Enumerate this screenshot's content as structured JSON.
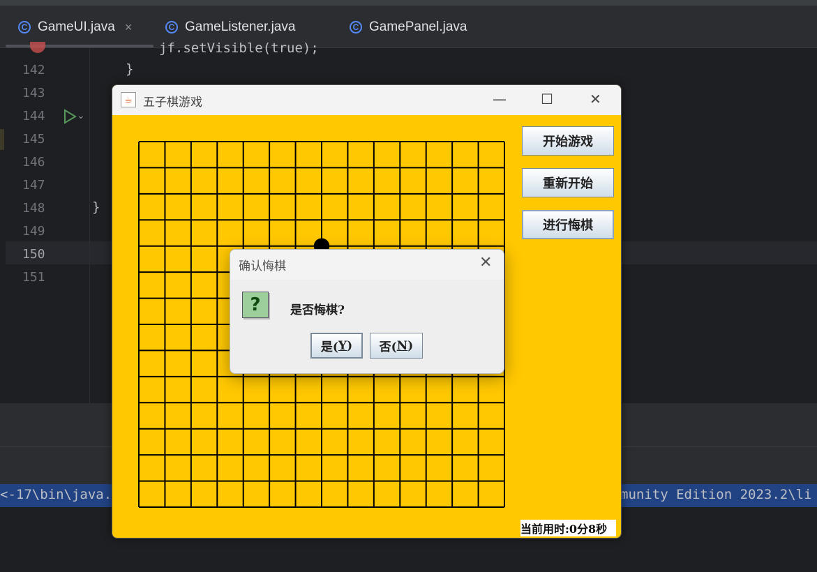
{
  "ide": {
    "tabs": [
      {
        "label": "GameUI.java",
        "icon": "class-icon",
        "active": true,
        "close": "×"
      },
      {
        "label": "GameListener.java",
        "icon": "class-icon",
        "active": false
      },
      {
        "label": "GamePanel.java",
        "icon": "class-icon",
        "active": false
      }
    ],
    "tab_icon_glyph": "C",
    "line_numbers": [
      "142",
      "143",
      "144",
      "145",
      "146",
      "147",
      "148",
      "149",
      "150",
      "151"
    ],
    "code_lines": {
      "top_partial": "jf.setVisible(true);",
      "l142": "}",
      "l148": "}"
    },
    "console": {
      "left": "<-17\\bin\\java.",
      "right": "munity Edition 2023.2\\li"
    }
  },
  "game_window": {
    "title": "五子棋游戏",
    "controls": {
      "minimize": "—",
      "maximize": "☐",
      "close": "✕"
    },
    "buttons": {
      "start": "开始游戏",
      "restart": "重新开始",
      "undo": "进行悔棋"
    },
    "timer_text": "当前用时:0分8秒",
    "board": {
      "lines": 15,
      "stones": [
        {
          "color": "black",
          "col": 7,
          "row": 4
        }
      ]
    },
    "colors": {
      "background": "#ffc800",
      "grid": "#000000"
    }
  },
  "dialog": {
    "title": "确认悔棋",
    "close": "✕",
    "message": "是否悔棋?",
    "icon": "question-icon",
    "icon_glyph": "?",
    "yes": {
      "prefix": "是(",
      "key": "Y",
      "suffix": ")"
    },
    "no": {
      "prefix": "否(",
      "key": "N",
      "suffix": ")"
    }
  }
}
